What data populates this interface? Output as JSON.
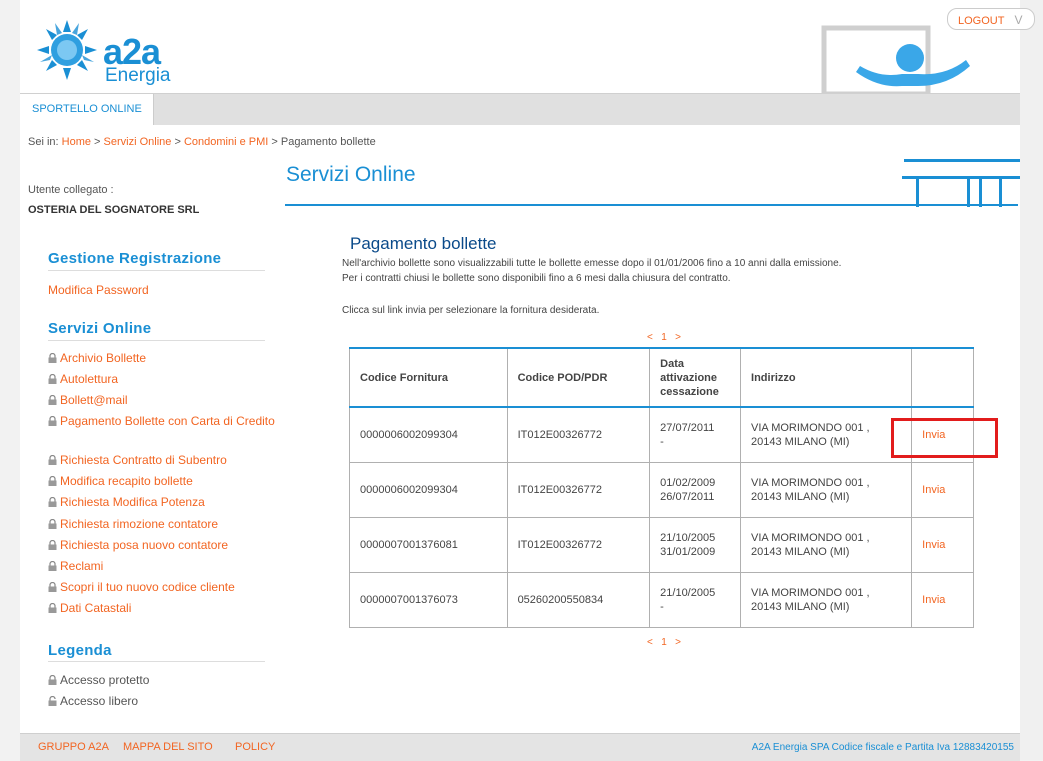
{
  "header": {
    "logo_main": "a2a",
    "logo_sub": "Energia",
    "logout_label": "LOGOUT",
    "logout_chevron": "V"
  },
  "topbar": {
    "tab_label": "SPORTELLO ONLINE"
  },
  "breadcrumb": {
    "prefix": "Sei in:",
    "items": [
      "Home",
      "Servizi Online",
      "Condomini e PMI"
    ],
    "current": "Pagamento bollette",
    "separator": ">"
  },
  "user": {
    "label": "Utente collegato :",
    "name": "OSTERIA DEL SOGNATORE SRL"
  },
  "sidebar": {
    "gestione_title": "Gestione Registrazione",
    "modifica_password": "Modifica Password",
    "servizi_title": "Servizi Online",
    "items": [
      "Archivio Bollette",
      "Autolettura",
      "Bollett@mail",
      "Pagamento Bollette con Carta di Credito",
      "Richiesta Contratto di Subentro",
      "Modifica recapito bollette",
      "Richiesta Modifica Potenza",
      "Richiesta rimozione contatore",
      "Richiesta posa nuovo contatore",
      "Reclami",
      "Scopri il tuo nuovo codice cliente",
      "Dati Catastali"
    ],
    "legenda_title": "Legenda",
    "legend_protected": "Accesso protetto",
    "legend_free": "Accesso libero"
  },
  "main": {
    "title": "Servizi Online",
    "subtitle": "Pagamento bollette",
    "desc1": "Nell'archivio bollette sono visualizzabili tutte le bollette emesse dopo il 01/01/2006 fino a 10 anni dalla emissione.",
    "desc2": "Per i contratti chiusi le bollette sono disponibili fino a 6 mesi dalla chiusura del contratto.",
    "desc3": "Clicca sul link invia per selezionare la fornitura desiderata.",
    "pager_prev": "<",
    "pager_page": "1",
    "pager_next": ">"
  },
  "table": {
    "headers": [
      "Codice Fornitura",
      "Codice POD/PDR",
      "Data attivazione cessazione",
      "Indirizzo",
      ""
    ],
    "rows": [
      {
        "fornitura": "0000006002099304",
        "pod": "IT012E00326772",
        "attivazione": "27/07/2011",
        "cessazione": "-",
        "addr1": "VIA MORIMONDO 001 ,",
        "addr2": "20143 MILANO (MI)",
        "action": "Invia"
      },
      {
        "fornitura": "0000006002099304",
        "pod": "IT012E00326772",
        "attivazione": "01/02/2009",
        "cessazione": "26/07/2011",
        "addr1": "VIA MORIMONDO 001 ,",
        "addr2": "20143 MILANO (MI)",
        "action": "Invia"
      },
      {
        "fornitura": "0000007001376081",
        "pod": "IT012E00326772",
        "attivazione": "21/10/2005",
        "cessazione": "31/01/2009",
        "addr1": "VIA MORIMONDO 001 ,",
        "addr2": "20143 MILANO (MI)",
        "action": "Invia"
      },
      {
        "fornitura": "0000007001376073",
        "pod": "05260200550834",
        "attivazione": "21/10/2005",
        "cessazione": "-",
        "addr1": "VIA MORIMONDO 001 ,",
        "addr2": "20143 MILANO (MI)",
        "action": "Invia"
      }
    ]
  },
  "footer": {
    "links": [
      "GRUPPO A2A",
      "MAPPA DEL SITO",
      "POLICY"
    ],
    "copyright": "A2A Energia SPA Codice fiscale e Partita Iva 12883420155"
  },
  "colors": {
    "brand_blue": "#1a8fd4",
    "link_orange": "#f26522",
    "highlight_red": "#e21c1c"
  }
}
